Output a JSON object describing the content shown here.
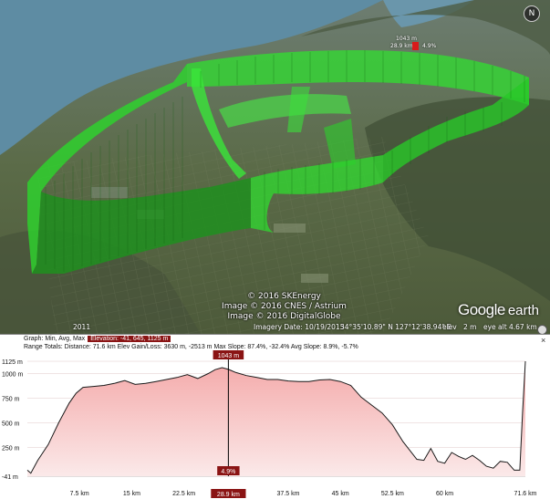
{
  "map": {
    "attribution": [
      "© 2016 SKEnergy",
      "Image © 2016 CNES / Astrium",
      "Image © 2016 DigitalGlobe"
    ],
    "logo_google": "Google",
    "logo_earth": "earth",
    "year": "2011",
    "imagery_date": "Imagery Date: 10/19/2015",
    "coordinates": "34°35'10.89\" N 127°12'38.94\" E",
    "elev_label": "elev",
    "elev_value": "2 m",
    "eye_alt_label": "eye alt",
    "eye_alt_value": "4.67 km",
    "compass": "N",
    "marker": {
      "elevation": "1043 m",
      "position": "28.9 km",
      "slope": "4.9%"
    },
    "colors": {
      "track": "#2bdc2b",
      "water": "#5f8aa0",
      "land": "#5f7050"
    }
  },
  "profile": {
    "header_row1_label": "Graph: Min, Avg, Max",
    "header_row1_value": "Elevation: -41, 645, 1125 m",
    "header_row2_label": "Range Totals:",
    "header_row2_value": "Distance: 71.6 km   Elev Gain/Loss: 3630 m, -2513 m  Max Slope: 87.4%, -32.4%  Avg Slope: 8.9%, -5.7%",
    "close": "×",
    "cursor_elevation": "1043 m",
    "cursor_slope": "4.9%",
    "cursor_distance": "28.9 km"
  },
  "chart_data": {
    "type": "area",
    "xlabel": "",
    "ylabel": "",
    "x_unit": "km",
    "y_unit": "m",
    "xlim": [
      0,
      71.6
    ],
    "ylim": [
      -41,
      1125
    ],
    "y_ticks": [
      "1125 m",
      "1000 m",
      "750 m",
      "500 m",
      "250 m",
      "-41 m"
    ],
    "y_tick_values": [
      1125,
      1000,
      750,
      500,
      250,
      -41
    ],
    "x_ticks": [
      "7.5 km",
      "15 km",
      "22.5 km",
      "28.9 km",
      "37.5 km",
      "45 km",
      "52.5 km",
      "60 km",
      "71.6 km"
    ],
    "x_tick_values": [
      7.5,
      15,
      22.5,
      28.9,
      37.5,
      45,
      52.5,
      60,
      71.6
    ],
    "cursor_x": 28.9,
    "x": [
      0,
      0.5,
      1.5,
      3,
      4.5,
      6,
      7,
      8,
      9.5,
      11,
      12.5,
      14,
      15.5,
      17,
      18.5,
      20,
      21.5,
      23,
      24.5,
      26,
      27,
      28,
      28.9,
      30,
      31.5,
      33,
      34.5,
      36,
      37.5,
      39,
      40.5,
      42,
      43.5,
      45,
      46.5,
      48,
      49.5,
      51,
      52.5,
      54,
      55,
      56,
      57,
      58,
      59,
      60,
      61,
      62,
      63,
      64,
      65,
      66,
      67,
      68,
      69,
      70,
      70.8,
      71.2,
      71.6
    ],
    "y": [
      20,
      -10,
      120,
      280,
      500,
      700,
      800,
      860,
      870,
      880,
      900,
      930,
      890,
      900,
      920,
      940,
      960,
      990,
      950,
      1000,
      1040,
      1060,
      1043,
      1010,
      980,
      960,
      940,
      940,
      925,
      920,
      920,
      935,
      940,
      920,
      880,
      760,
      680,
      600,
      480,
      310,
      220,
      130,
      120,
      240,
      110,
      90,
      200,
      160,
      130,
      170,
      120,
      60,
      40,
      110,
      100,
      20,
      20,
      600,
      1125
    ],
    "colors": {
      "line": "#1a1a1a",
      "fill_top": "#f4a9a9",
      "fill_bottom": "#fbe9e9",
      "cursor": "#000000",
      "tag": "#8a1414"
    }
  }
}
